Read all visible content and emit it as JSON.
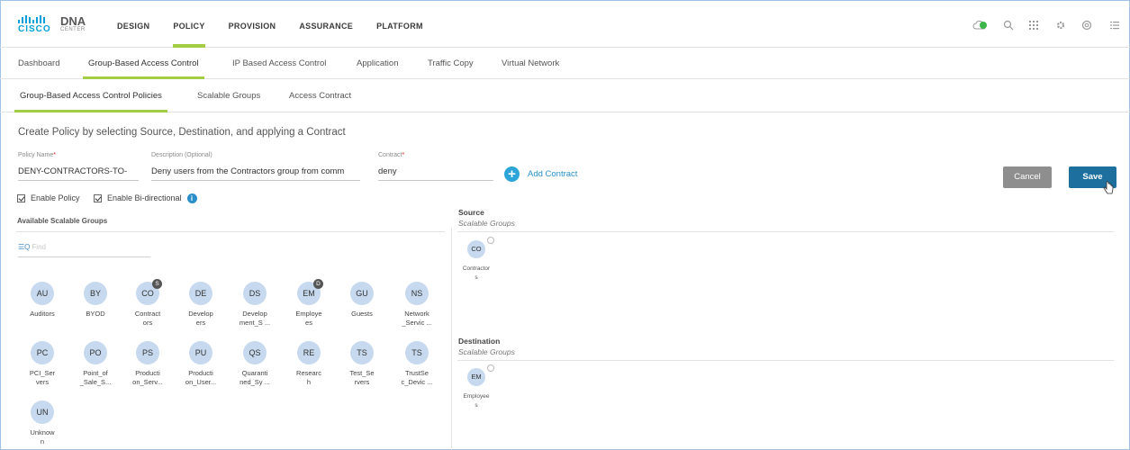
{
  "brand": {
    "cisco": "CISCO",
    "product": "DNA",
    "sub": "CENTER"
  },
  "main_nav": [
    "DESIGN",
    "POLICY",
    "PROVISION",
    "ASSURANCE",
    "PLATFORM"
  ],
  "sub_nav": [
    "Dashboard",
    "Group-Based Access Control",
    "IP Based Access Control",
    "Application",
    "Traffic Copy",
    "Virtual Network"
  ],
  "tabs": [
    "Group-Based Access Control Policies",
    "Scalable Groups",
    "Access Contract"
  ],
  "heading": "Create Policy by selecting Source, Destination, and applying a Contract",
  "form": {
    "policy_name_label": "Policy Name",
    "policy_name_value": "DENY-CONTRACTORS-TO-",
    "description_label": "Description (Optional)",
    "description_value": "Deny users from the Contractors group from comm",
    "contract_label": "Contract",
    "contract_value": "deny",
    "add_contract": "Add Contract",
    "cancel": "Cancel",
    "save": "Save",
    "enable_policy": "Enable Policy",
    "enable_bidirectional": "Enable Bi-directional"
  },
  "available": {
    "title": "Available Scalable Groups",
    "find_placeholder": "Find",
    "groups": [
      {
        "abbr": "AU",
        "name": "Auditors",
        "badge": ""
      },
      {
        "abbr": "BY",
        "name": "BYOD",
        "badge": ""
      },
      {
        "abbr": "CO",
        "name": "Contract\nors",
        "badge": "S"
      },
      {
        "abbr": "DE",
        "name": "Develop\ners",
        "badge": ""
      },
      {
        "abbr": "DS",
        "name": "Develop\nment_S ...",
        "badge": ""
      },
      {
        "abbr": "EM",
        "name": "Employe\nes",
        "badge": "D"
      },
      {
        "abbr": "GU",
        "name": "Guests",
        "badge": ""
      },
      {
        "abbr": "NS",
        "name": "Network\n_Servic ...",
        "badge": ""
      },
      {
        "abbr": "PC",
        "name": "PCI_Ser\nvers",
        "badge": ""
      },
      {
        "abbr": "PO",
        "name": "Point_of\n_Sale_S...",
        "badge": ""
      },
      {
        "abbr": "PS",
        "name": "Producti\non_Serv...",
        "badge": ""
      },
      {
        "abbr": "PU",
        "name": "Producti\non_User...",
        "badge": ""
      },
      {
        "abbr": "QS",
        "name": "Quaranti\nned_Sy ...",
        "badge": ""
      },
      {
        "abbr": "RE",
        "name": "Researc\nh",
        "badge": ""
      },
      {
        "abbr": "TS",
        "name": "Test_Se\nrvers",
        "badge": ""
      },
      {
        "abbr": "TS",
        "name": "TrustSe\nc_Devic ...",
        "badge": ""
      },
      {
        "abbr": "UN",
        "name": "Unknow\nn",
        "badge": ""
      }
    ]
  },
  "source": {
    "title": "Source",
    "subtitle": "Scalable Groups",
    "group": {
      "abbr": "CO",
      "name": "Contractor\ns"
    }
  },
  "destination": {
    "title": "Destination",
    "subtitle": "Scalable Groups",
    "group": {
      "abbr": "EM",
      "name": "Employee\ns"
    }
  },
  "colors": {
    "accent": "#a2cd45",
    "primary": "#1d6f9e",
    "link": "#2a8fc9",
    "chip": "#c6d9ee"
  }
}
